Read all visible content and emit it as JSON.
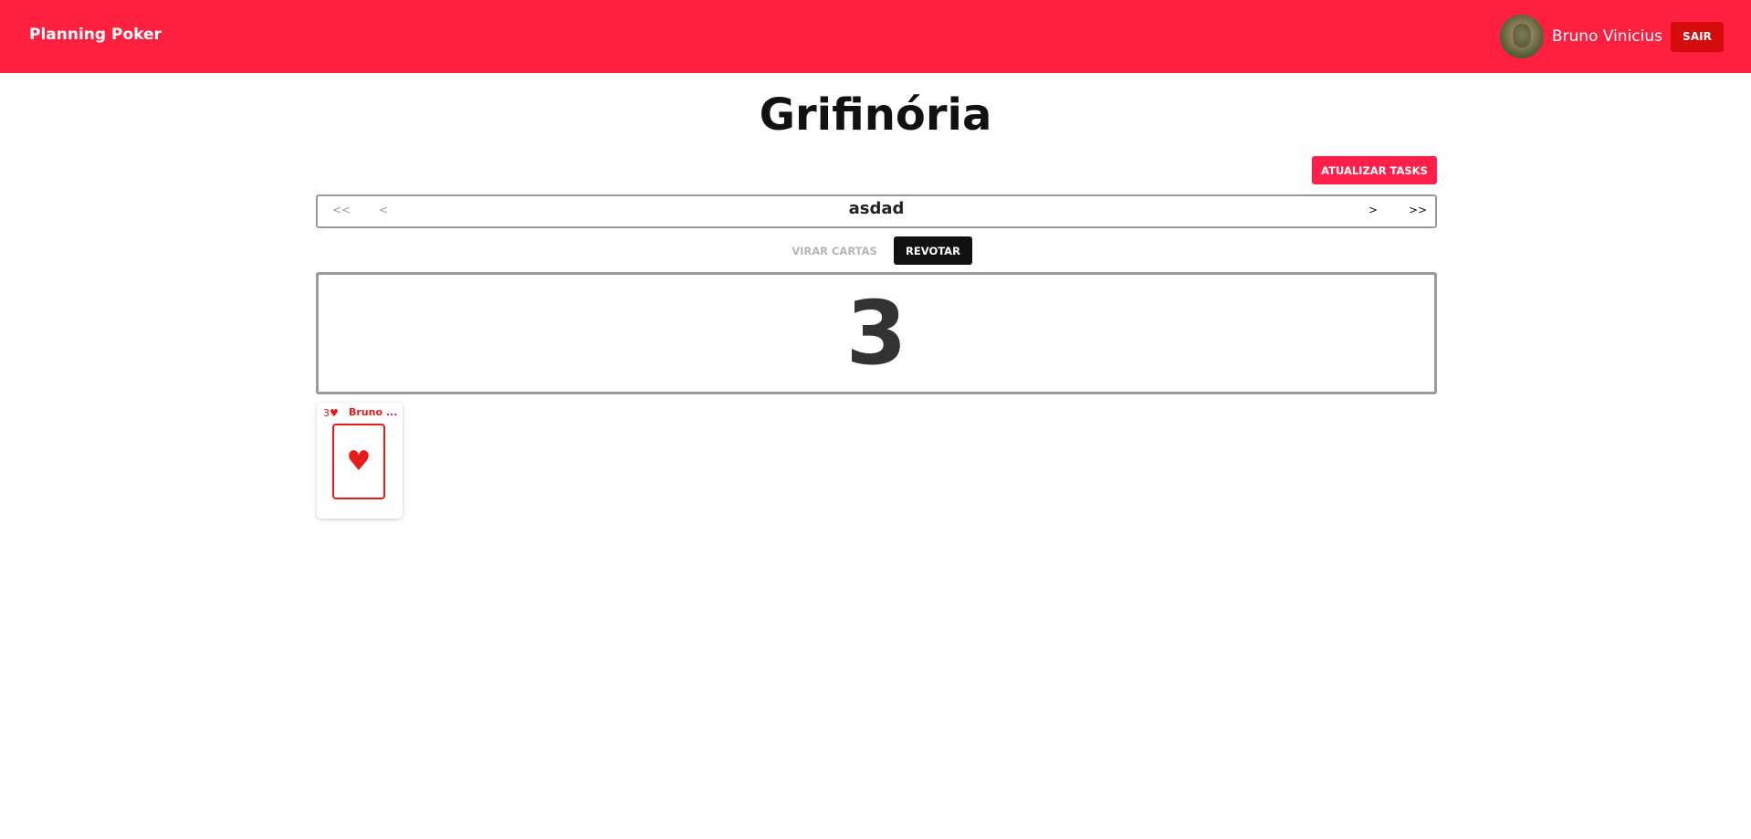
{
  "header": {
    "brand": "Planning Poker",
    "user_name": "Bruno Vinicius",
    "logout_label": "SAIR",
    "background_color": "#ff1f3f"
  },
  "room": {
    "title": "Grifinória"
  },
  "actions": {
    "update_tasks_label": "ATUALIZAR TASKS",
    "flip_cards_label": "VIRAR CARTAS",
    "revote_label": "REVOTAR"
  },
  "task_nav": {
    "first_label": "<<",
    "prev_label": "<",
    "current_task": "asdad",
    "next_label": ">",
    "last_label": ">>"
  },
  "result": {
    "value": "3"
  },
  "votes": [
    {
      "corner": "3♥",
      "voter": "Bruno ...",
      "suit": "♥",
      "color": "#e81a1a"
    }
  ]
}
